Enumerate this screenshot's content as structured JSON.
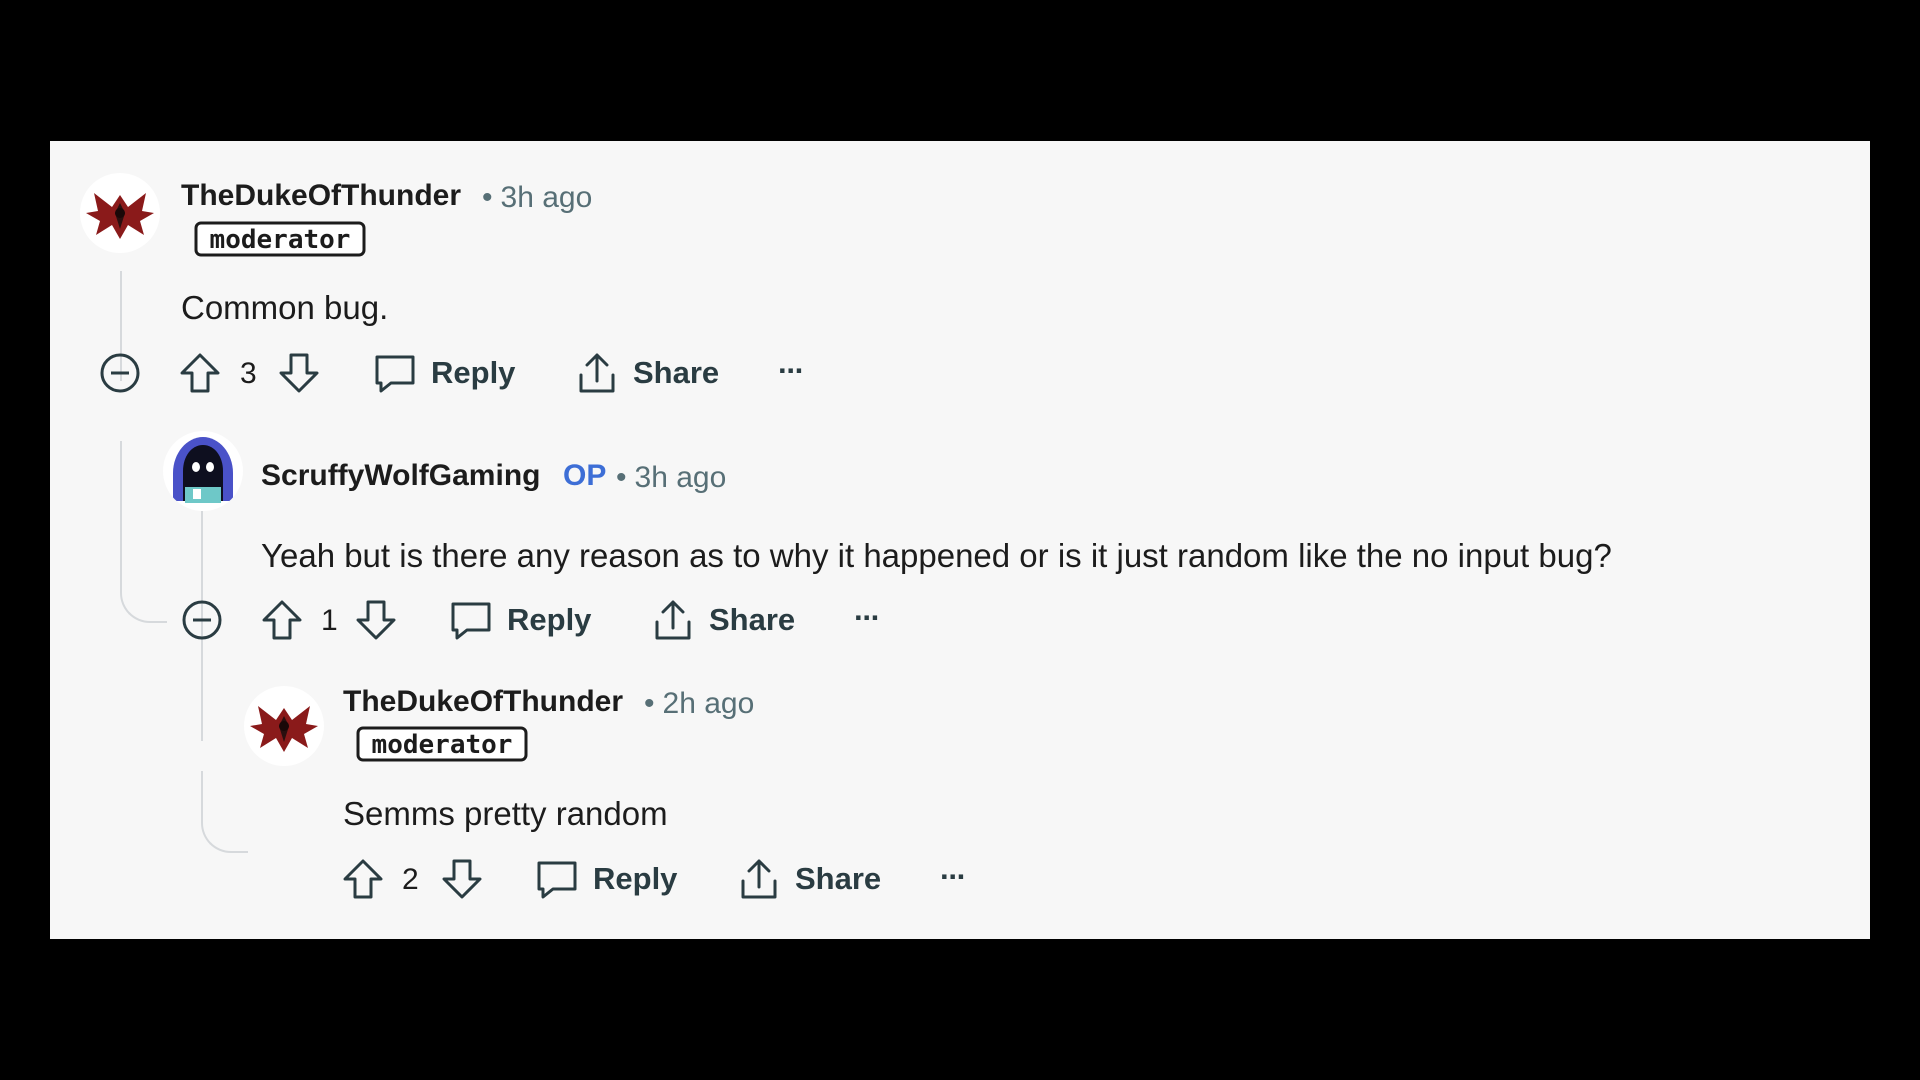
{
  "comments": [
    {
      "username": "TheDukeOfThunder",
      "timestamp": "3h ago",
      "flair": "moderator",
      "body": "Common bug.",
      "score": "3",
      "reply_label": "Reply",
      "share_label": "Share",
      "more_label": "···"
    },
    {
      "username": "ScruffyWolfGaming",
      "op_badge": "OP",
      "timestamp": "3h ago",
      "body": "Yeah but is there any reason as to why it happened or is it just random like the no input bug?",
      "score": "1",
      "reply_label": "Reply",
      "share_label": "Share",
      "more_label": "···"
    },
    {
      "username": "TheDukeOfThunder",
      "timestamp": "2h ago",
      "flair": "moderator",
      "body": "Semms pretty random",
      "score": "2",
      "reply_label": "Reply",
      "share_label": "Share",
      "more_label": "···"
    }
  ],
  "colors": {
    "background": "#f7f7f7",
    "text": "#1c1c1c",
    "meta": "#576f76",
    "op": "#3d6ed6",
    "thread_line": "#d6d9dc"
  },
  "icons": [
    "collapse-icon",
    "upvote-icon",
    "downvote-icon",
    "comment-icon",
    "share-icon",
    "more-icon"
  ]
}
